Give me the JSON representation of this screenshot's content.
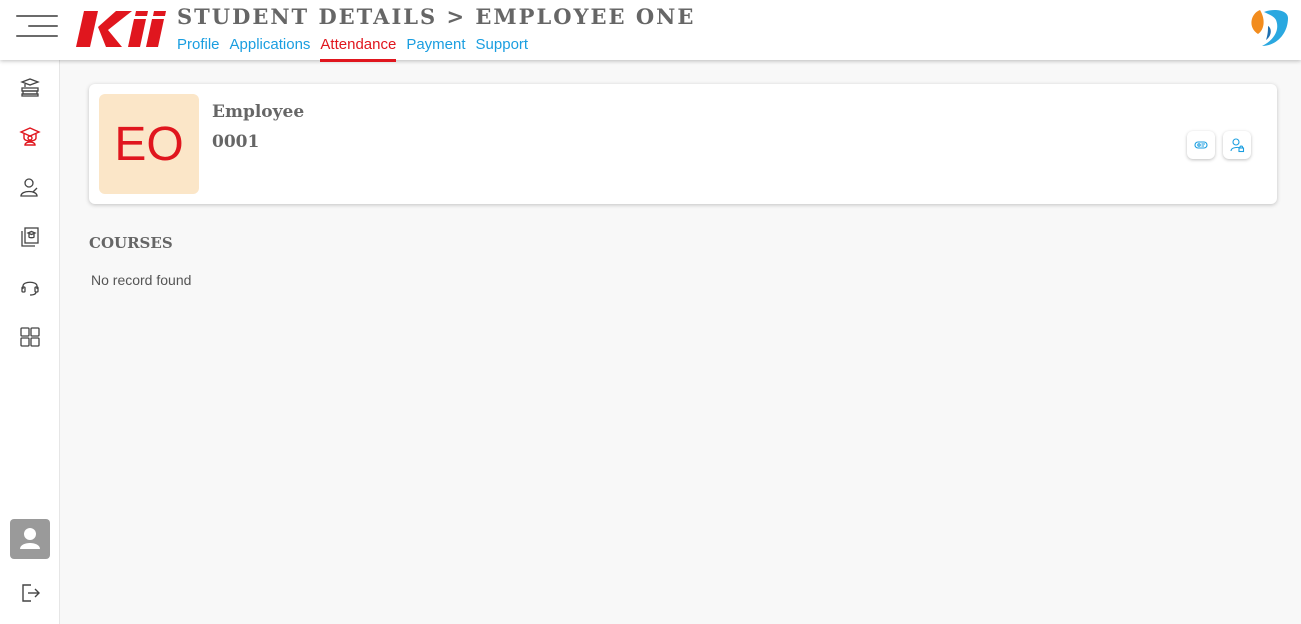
{
  "header": {
    "brand_logo_text": "KII",
    "title": "STUDENT DETAILS > EMPLOYEE ONE",
    "tabs": [
      {
        "label": "Profile",
        "active": false
      },
      {
        "label": "Applications",
        "active": false
      },
      {
        "label": "Attendance",
        "active": true
      },
      {
        "label": "Payment",
        "active": false
      },
      {
        "label": "Support",
        "active": false
      }
    ]
  },
  "sidebar": {
    "items": [
      {
        "icon": "graduation-books-icon",
        "active": false
      },
      {
        "icon": "student-cap-icon",
        "active": true
      },
      {
        "icon": "user-profile-icon",
        "active": false
      },
      {
        "icon": "courses-icon",
        "active": false
      },
      {
        "icon": "headset-icon",
        "active": false
      },
      {
        "icon": "dashboard-grid-icon",
        "active": false
      }
    ],
    "bottom": [
      {
        "icon": "user-avatar-icon"
      },
      {
        "icon": "logout-icon"
      }
    ]
  },
  "profile": {
    "initials": "EO",
    "name": "Employee",
    "id": "0001",
    "actions": [
      {
        "icon": "id-card-icon"
      },
      {
        "icon": "user-lock-icon"
      }
    ]
  },
  "courses": {
    "title": "COURSES",
    "empty_message": "No record found"
  },
  "colors": {
    "accent_red": "#e0161e",
    "link_blue": "#1a9ee0",
    "initials_bg": "#fbe6c8",
    "text_gray": "#666666"
  }
}
